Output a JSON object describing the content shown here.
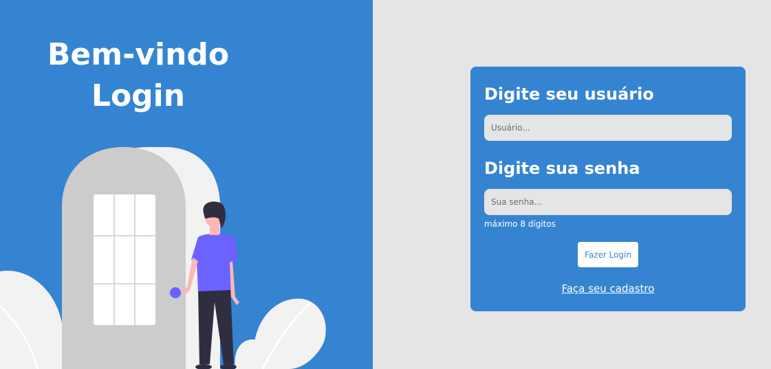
{
  "welcome": {
    "line1": "Bem-vindo",
    "line2": "Login"
  },
  "login_form": {
    "username_heading": "Digite seu usuário",
    "username_placeholder": "Usuário...",
    "username_value": "",
    "password_heading": "Digite sua senha",
    "password_placeholder": "Sua senha...",
    "password_value": "",
    "password_hint": "máximo 8 dígitos",
    "submit_label": "Fazer Login",
    "signup_link": "Faça seu cadastro"
  },
  "colors": {
    "primary_blue": "#3584d2",
    "background_gray": "#e5e5e5",
    "door_gray": "#cccccc",
    "shirt_purple": "#6c63ff",
    "pants_dark": "#2f2e41",
    "skin": "#ffb6b6"
  },
  "icons": {
    "illustration": "person-opening-door-illustration"
  }
}
